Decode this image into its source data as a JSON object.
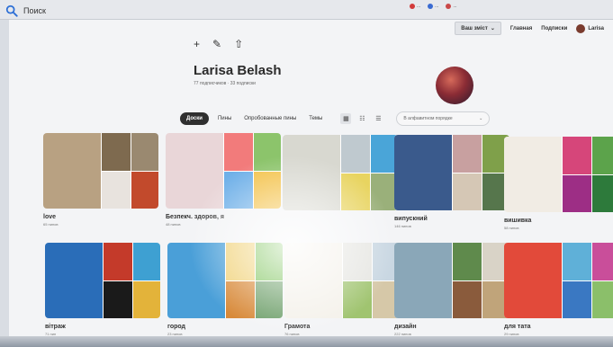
{
  "browser": {
    "search_placeholder": "Поиск",
    "tabs": [
      {
        "label": "...",
        "color": "#d23a3a"
      },
      {
        "label": "...",
        "color": "#3a6bd2"
      },
      {
        "label": "...",
        "color": "#c94848"
      }
    ]
  },
  "nav": {
    "pill_label": "Ваш зміст",
    "home": "Главная",
    "subscriptions": "Подписки",
    "user": "Larisa"
  },
  "profile": {
    "name": "Larisa Belash",
    "followers": "77 подписчиков · 33 подписки"
  },
  "tabs": {
    "boards": "Доски",
    "pins": "Пины",
    "tried": "Опробованные пины",
    "topics": "Темы"
  },
  "sort": {
    "label": "В алфавитном порядке"
  },
  "boards": [
    {
      "title": "love",
      "count": "65 пинов",
      "colors": [
        "#b8a182",
        "#7e6a4f",
        "#9a8970",
        "#e8e3de",
        "#c24a2c"
      ]
    },
    {
      "title": "Безпекч. здоров, я",
      "count": "48 пинов",
      "colors": [
        "#e9d6d8",
        "#f27b7b",
        "#8cc46b",
        "#6fb0e8",
        "#f3c24a"
      ]
    },
    {
      "title": "",
      "count": "",
      "colors": [
        "#d8d8d0",
        "#bfc9cf",
        "#4aa5d8",
        "#e8d460",
        "#9ab07a"
      ]
    },
    {
      "title": "випускний",
      "count": "146 пинов",
      "colors": [
        "#3a5a8c",
        "#c8a0a0",
        "#7fa04a",
        "#d5c7b5",
        "#56764c"
      ]
    },
    {
      "title": "вишивка",
      "count": "58 пинов",
      "colors": [
        "#f1ece4",
        "#d6467a",
        "#5ca34b",
        "#9d2e85",
        "#2d7a3b"
      ]
    },
    {
      "title": "вітраж",
      "count": "71 пин",
      "colors": [
        "#2a6db8",
        "#c43a2a",
        "#3ea0d2",
        "#1a1a1a",
        "#e3b33a"
      ]
    },
    {
      "title": "город",
      "count": "23 пинов",
      "colors": [
        "#4a9fd8",
        "#f0d27a",
        "#7cc35a",
        "#d88a3a",
        "#6fa06b"
      ]
    },
    {
      "title": "Грамота",
      "count": "76 пинов",
      "colors": [
        "#f4f1ea",
        "#e6e6e2",
        "#c9d7e2",
        "#a0c470",
        "#d6c8a8"
      ]
    },
    {
      "title": "дизайн",
      "count": "222 пинов",
      "colors": [
        "#8aa7b8",
        "#5f8a4c",
        "#d9d3c7",
        "#8a5b3c",
        "#c0a47a"
      ]
    },
    {
      "title": "для тата",
      "count": "29 пинов",
      "colors": [
        "#e24a3a",
        "#5fb0d8",
        "#c94e9a",
        "#3a78c2",
        "#8bbf6a"
      ]
    }
  ]
}
